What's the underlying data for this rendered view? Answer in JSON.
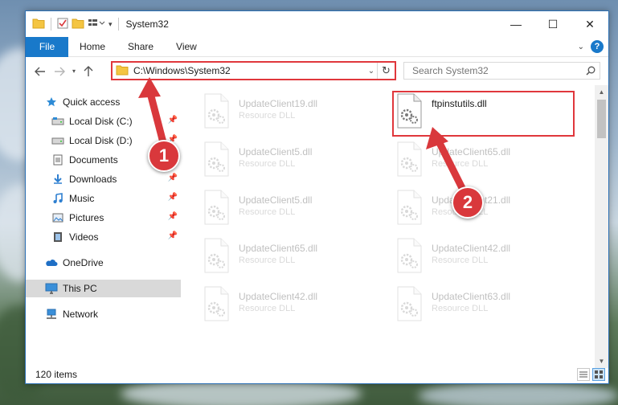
{
  "window": {
    "title": "System32",
    "controls": {
      "minimize": "—",
      "maximize": "☐",
      "close": "✕"
    }
  },
  "ribbon": {
    "tabs": [
      "File",
      "Home",
      "Share",
      "View"
    ],
    "help": "?"
  },
  "navbar": {
    "address_path": "C:\\Windows\\System32",
    "search_placeholder": "Search System32"
  },
  "sidebar": {
    "items": [
      {
        "label": "Quick access",
        "icon": "star-icon",
        "pinned": false
      },
      {
        "label": "Local Disk (C:)",
        "icon": "drive-icon",
        "pinned": true
      },
      {
        "label": "Local Disk (D:)",
        "icon": "drive-icon",
        "pinned": true
      },
      {
        "label": "Documents",
        "icon": "documents-icon",
        "pinned": true
      },
      {
        "label": "Downloads",
        "icon": "download-icon",
        "pinned": true
      },
      {
        "label": "Music",
        "icon": "music-icon",
        "pinned": true
      },
      {
        "label": "Pictures",
        "icon": "pictures-icon",
        "pinned": true
      },
      {
        "label": "Videos",
        "icon": "videos-icon",
        "pinned": true
      },
      {
        "label": "OneDrive",
        "icon": "onedrive-icon",
        "pinned": false
      },
      {
        "label": "This PC",
        "icon": "computer-icon",
        "pinned": false,
        "selected": true
      },
      {
        "label": "Network",
        "icon": "network-icon",
        "pinned": false
      }
    ]
  },
  "files": {
    "left": [
      {
        "name": "UpdateClient19.dll",
        "type": "Resource DLL"
      },
      {
        "name": "UpdateClient5.dll",
        "type": "Resource DLL"
      },
      {
        "name": "UpdateClient5.dll",
        "type": "Resource DLL"
      },
      {
        "name": "UpdateClient65.dll",
        "type": "Resource DLL"
      },
      {
        "name": "UpdateClient42.dll",
        "type": "Resource DLL"
      }
    ],
    "right": [
      {
        "name": "ftpinstutils.dll",
        "type": "",
        "highlighted": true
      },
      {
        "name": "UpdateClient65.dll",
        "type": "Resource DLL"
      },
      {
        "name": "UpdateClient21.dll",
        "type": "Resource DLL"
      },
      {
        "name": "UpdateClient42.dll",
        "type": "Resource DLL"
      },
      {
        "name": "UpdateClient63.dll",
        "type": "Resource DLL"
      }
    ]
  },
  "status": {
    "item_count": "120 items"
  },
  "markers": [
    "1",
    "2"
  ],
  "colors": {
    "accent": "#1979ca",
    "annotation": "#e0373c"
  }
}
